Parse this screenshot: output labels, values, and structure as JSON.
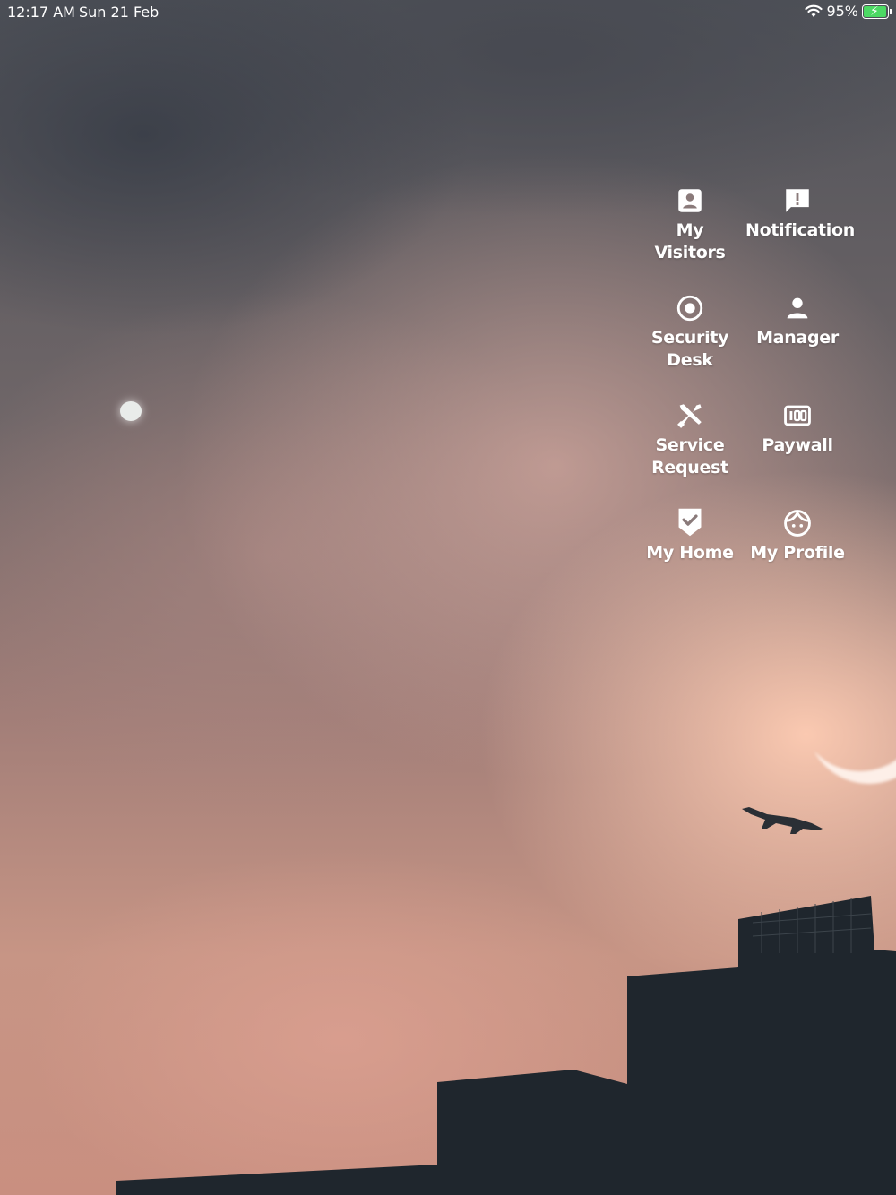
{
  "status_bar": {
    "time": "12:17 AM",
    "date": "Sun 21 Feb",
    "battery_percent_text": "95%",
    "battery_level": 0.95,
    "battery_color": "#4cd964"
  },
  "menu": {
    "items": [
      {
        "label": "My Visitors",
        "icon": "visitor-badge-icon"
      },
      {
        "label": "Notification",
        "icon": "alert-message-icon"
      },
      {
        "label": "Security\nDesk",
        "icon": "radio-target-icon"
      },
      {
        "label": "Manager",
        "icon": "person-icon"
      },
      {
        "label": "Service\nRequest",
        "icon": "tools-icon"
      },
      {
        "label": "Paywall",
        "icon": "counter-icon"
      },
      {
        "label": "My Home",
        "icon": "shield-check-icon"
      },
      {
        "label": "My Profile",
        "icon": "face-icon"
      }
    ]
  }
}
